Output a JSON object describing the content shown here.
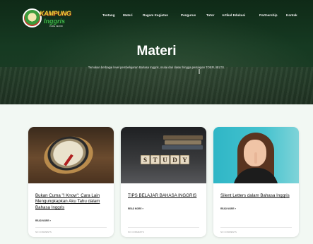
{
  "brand": {
    "title": "KAMPUNG",
    "subtitle": "Inggris",
    "tagline": "PARE KEDIRI"
  },
  "nav": {
    "items": [
      "Tentang",
      "Materi",
      "Ragam Kegiatan",
      "Pengurus",
      "Tutor",
      "Artikel Edukasi",
      "Partnership",
      "Kontak"
    ]
  },
  "hero": {
    "title": "Materi",
    "subtitle": "Temukan berbagai level pembelajaran Bahasa Inggris, mulai dari dasar hingga persiapan TOEFL/IELTS."
  },
  "cards": [
    {
      "image": "compass-photo",
      "title": "Bukan Cuma \"I Know\": Cara Lain Mengungkapkan Aku Tahu dalam Bahasa Inggris",
      "read_more": "READ MORE »",
      "meta": "NO COMMENTS"
    },
    {
      "image": "study-blocks-photo",
      "title": "TIPS BELAJAR BAHASA INGGRIS",
      "read_more": "READ MORE »",
      "meta": "NO COMMENTS",
      "image_text": "STUDY"
    },
    {
      "image": "woman-shush-photo",
      "title": "Silent Letters dalam Bahasa Inggris",
      "read_more": "READ MORE »",
      "meta": "NO COMMENTS"
    }
  ],
  "colors": {
    "hero_bg": "#163a22",
    "content_bg": "#f2f8f3",
    "brand_yellow": "#f5d53a",
    "brand_green": "#3fb24a"
  }
}
